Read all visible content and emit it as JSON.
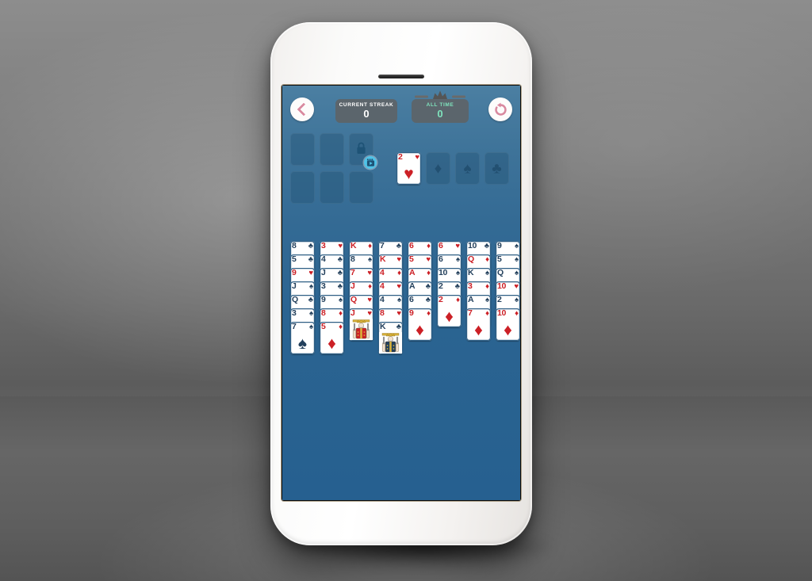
{
  "device": {
    "type": "smartphone",
    "color": "white",
    "orientation": "portrait"
  },
  "app": {
    "name": "FreeCell Solitaire",
    "background_color": "#2a6492"
  },
  "topbar": {
    "back_button": {
      "icon": "chevron-left-icon",
      "color": "#d9899f"
    },
    "reset_button": {
      "icon": "restart-icon",
      "color": "#d9899f"
    },
    "stats": [
      {
        "id": "current-streak",
        "label": "CURRENT STREAK",
        "value": "0",
        "color": "#ffffff"
      },
      {
        "id": "all-time",
        "label": "ALL TIME",
        "value": "0",
        "color": "#7fe3bd",
        "has_crown": true
      }
    ]
  },
  "free_cells": [
    {
      "index": 0,
      "state": "empty",
      "card": null
    },
    {
      "index": 1,
      "state": "empty",
      "card": null
    },
    {
      "index": 2,
      "state": "locked",
      "card": null,
      "lock_icon": "lock-icon",
      "unlock_badge": "video-ad-icon"
    },
    {
      "index": 3,
      "state": "empty",
      "card": null
    },
    {
      "index": 4,
      "state": "empty",
      "card": null
    },
    {
      "index": 5,
      "state": "empty",
      "card": null
    }
  ],
  "foundations": [
    {
      "suit": "hearts",
      "symbol": "♥",
      "card": {
        "rank": "2",
        "suit": "♥",
        "color": "red"
      }
    },
    {
      "suit": "diamonds",
      "symbol": "♦",
      "card": null
    },
    {
      "suit": "spades",
      "symbol": "♠",
      "card": null
    },
    {
      "suit": "clubs",
      "symbol": "♣",
      "card": null
    }
  ],
  "tableau": [
    {
      "column": 1,
      "cards": [
        {
          "rank": "8",
          "suit": "♣",
          "color": "black"
        },
        {
          "rank": "5",
          "suit": "♣",
          "color": "black"
        },
        {
          "rank": "9",
          "suit": "♥",
          "color": "red"
        },
        {
          "rank": "J",
          "suit": "♠",
          "color": "black"
        },
        {
          "rank": "Q",
          "suit": "♣",
          "color": "black"
        },
        {
          "rank": "3",
          "suit": "♠",
          "color": "black"
        },
        {
          "rank": "7",
          "suit": "♠",
          "color": "black"
        }
      ]
    },
    {
      "column": 2,
      "cards": [
        {
          "rank": "3",
          "suit": "♥",
          "color": "red"
        },
        {
          "rank": "4",
          "suit": "♣",
          "color": "black"
        },
        {
          "rank": "J",
          "suit": "♣",
          "color": "black"
        },
        {
          "rank": "3",
          "suit": "♣",
          "color": "black"
        },
        {
          "rank": "9",
          "suit": "♠",
          "color": "black"
        },
        {
          "rank": "8",
          "suit": "♦",
          "color": "red"
        },
        {
          "rank": "5",
          "suit": "♦",
          "color": "red"
        }
      ]
    },
    {
      "column": 3,
      "cards": [
        {
          "rank": "K",
          "suit": "♦",
          "color": "red"
        },
        {
          "rank": "8",
          "suit": "♠",
          "color": "black"
        },
        {
          "rank": "7",
          "suit": "♥",
          "color": "red"
        },
        {
          "rank": "J",
          "suit": "♦",
          "color": "red"
        },
        {
          "rank": "Q",
          "suit": "♥",
          "color": "red"
        },
        {
          "rank": "J",
          "suit": "♥",
          "color": "red",
          "face": true
        }
      ]
    },
    {
      "column": 4,
      "cards": [
        {
          "rank": "7",
          "suit": "♣",
          "color": "black"
        },
        {
          "rank": "K",
          "suit": "♥",
          "color": "red"
        },
        {
          "rank": "4",
          "suit": "♦",
          "color": "red"
        },
        {
          "rank": "4",
          "suit": "♥",
          "color": "red"
        },
        {
          "rank": "4",
          "suit": "♠",
          "color": "black"
        },
        {
          "rank": "8",
          "suit": "♥",
          "color": "red"
        },
        {
          "rank": "K",
          "suit": "♣",
          "color": "black",
          "face": true
        }
      ]
    },
    {
      "column": 5,
      "cards": [
        {
          "rank": "6",
          "suit": "♦",
          "color": "red"
        },
        {
          "rank": "5",
          "suit": "♥",
          "color": "red"
        },
        {
          "rank": "A",
          "suit": "♦",
          "color": "red"
        },
        {
          "rank": "A",
          "suit": "♣",
          "color": "black"
        },
        {
          "rank": "6",
          "suit": "♣",
          "color": "black"
        },
        {
          "rank": "9",
          "suit": "♦",
          "color": "red"
        }
      ]
    },
    {
      "column": 6,
      "cards": [
        {
          "rank": "6",
          "suit": "♥",
          "color": "red"
        },
        {
          "rank": "6",
          "suit": "♠",
          "color": "black"
        },
        {
          "rank": "10",
          "suit": "♠",
          "color": "black"
        },
        {
          "rank": "2",
          "suit": "♣",
          "color": "black"
        },
        {
          "rank": "2",
          "suit": "♦",
          "color": "red"
        }
      ]
    },
    {
      "column": 7,
      "cards": [
        {
          "rank": "10",
          "suit": "♣",
          "color": "black"
        },
        {
          "rank": "Q",
          "suit": "♦",
          "color": "red"
        },
        {
          "rank": "K",
          "suit": "♠",
          "color": "black"
        },
        {
          "rank": "3",
          "suit": "♦",
          "color": "red"
        },
        {
          "rank": "A",
          "suit": "♠",
          "color": "black"
        },
        {
          "rank": "7",
          "suit": "♦",
          "color": "red"
        }
      ]
    },
    {
      "column": 8,
      "cards": [
        {
          "rank": "9",
          "suit": "♠",
          "color": "black"
        },
        {
          "rank": "5",
          "suit": "♠",
          "color": "black"
        },
        {
          "rank": "Q",
          "suit": "♠",
          "color": "black"
        },
        {
          "rank": "10",
          "suit": "♥",
          "color": "red"
        },
        {
          "rank": "2",
          "suit": "♠",
          "color": "black"
        },
        {
          "rank": "10",
          "suit": "♦",
          "color": "red"
        }
      ]
    }
  ],
  "colors": {
    "card_red": "#cc2026",
    "card_black": "#23405c",
    "card_border": "#2f5f85",
    "accent_pink": "#d9899f",
    "accent_mint": "#7fe3bd",
    "ad_badge": "#4fc3e8"
  }
}
